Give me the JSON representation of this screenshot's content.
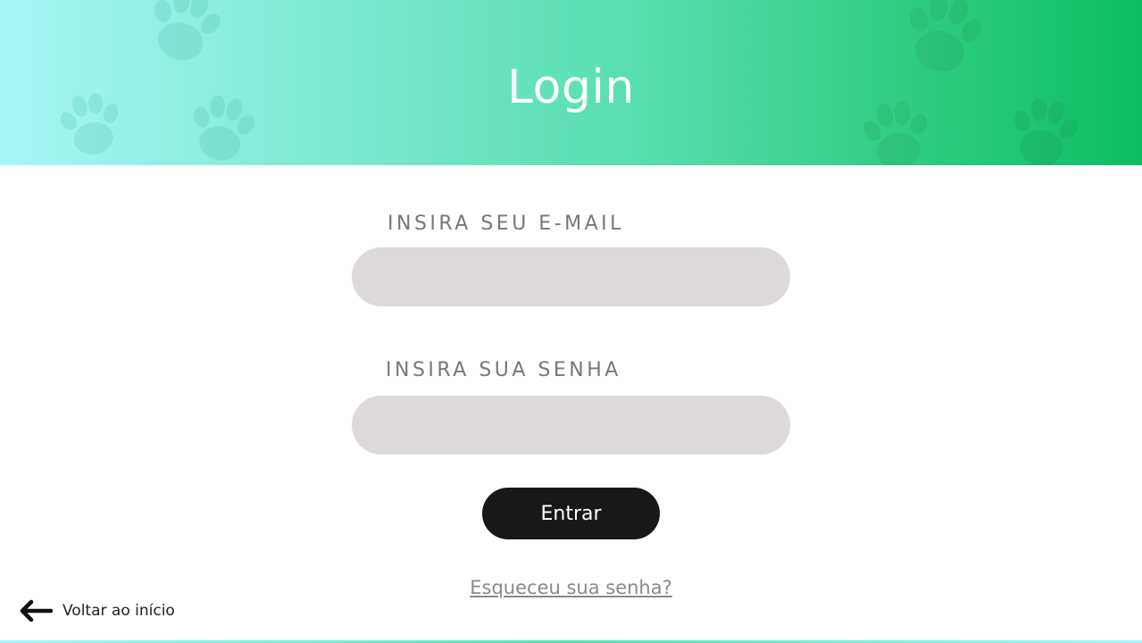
{
  "header": {
    "title": "Login",
    "gradient_start": "#a8f7f5",
    "gradient_end": "#0dbd63",
    "decoration_icon": "paw-print-icon"
  },
  "form": {
    "email_label": "INSIRA SEU E-MAIL",
    "email_value": "",
    "password_label": "INSIRA SUA SENHA",
    "password_value": "",
    "submit_label": "Entrar",
    "forgot_link": "Esqueceu sua senha?"
  },
  "footer": {
    "back_label": "Voltar ao início",
    "back_icon": "arrow-left-icon"
  },
  "colors": {
    "input_bg": "#dedada",
    "button_bg": "#181818",
    "label_text": "#777777"
  }
}
